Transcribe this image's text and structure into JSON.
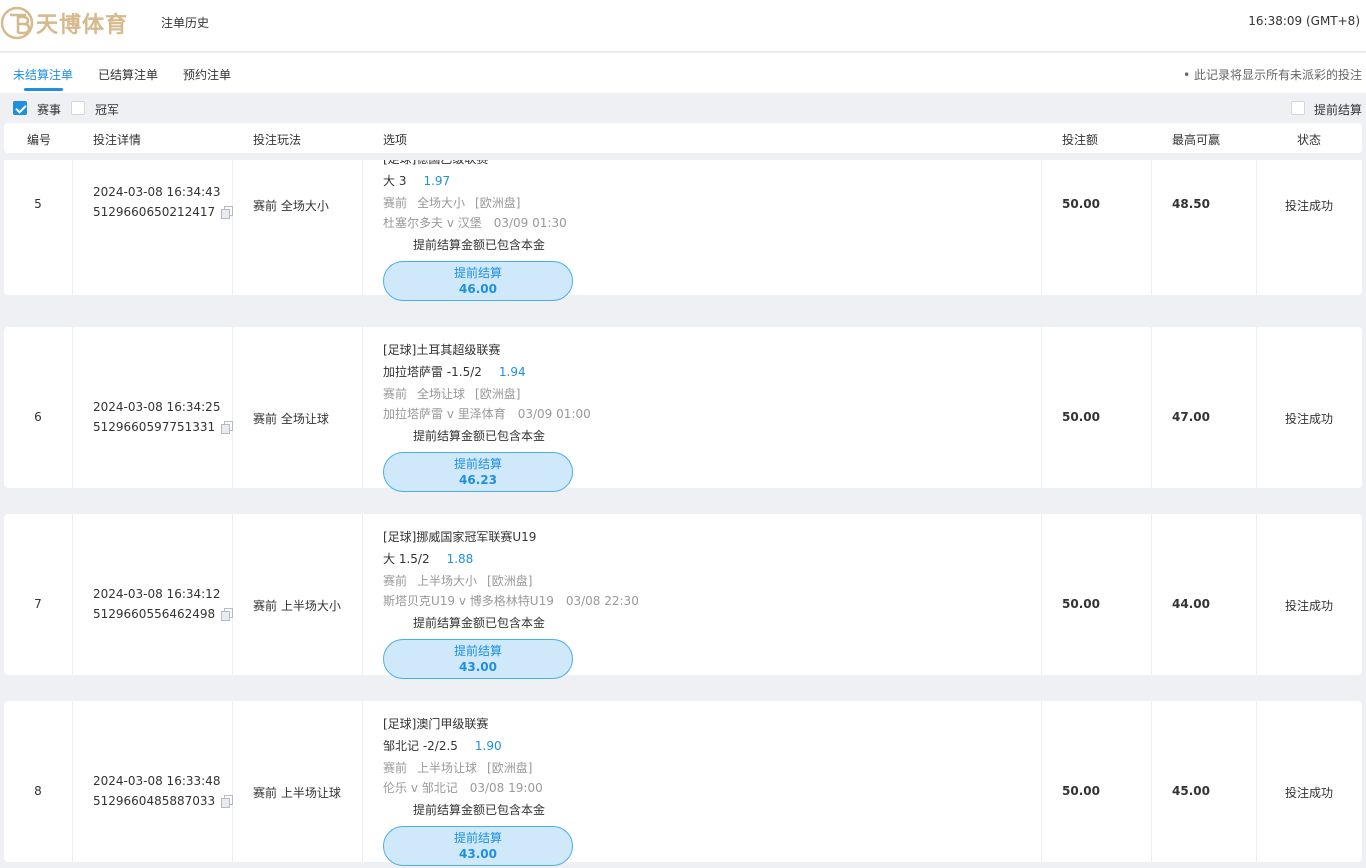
{
  "header": {
    "logo_text": "天博体育",
    "page_title": "注单历史",
    "clock": "16:38:09 (GMT+8)"
  },
  "tabs": [
    {
      "label": "未结算注单",
      "active": true
    },
    {
      "label": "已结算注单",
      "active": false
    },
    {
      "label": "预约注单",
      "active": false
    }
  ],
  "notice": "• 此记录将显示所有未派彩的投注",
  "filters": {
    "event": {
      "label": "赛事",
      "checked": true
    },
    "champion": {
      "label": "冠军",
      "checked": false
    },
    "early_settle": {
      "label": "提前结算",
      "checked": false
    }
  },
  "columns": {
    "num": "编号",
    "detail": "投注详情",
    "type": "投注玩法",
    "option": "选项",
    "stake": "投注额",
    "max_win": "最高可赢",
    "status": "状态"
  },
  "bets": [
    {
      "num": "5",
      "datetime": "2024-03-08 16:34:43",
      "bet_id": "5129660650212417",
      "type": "赛前 全场大小",
      "league": "[足球]德国乙级联赛",
      "pick": "大 3",
      "odds": "1.97",
      "meta": [
        "赛前",
        "全场大小",
        "[欧洲盘]"
      ],
      "match": "杜塞尔多夫 v 汉堡",
      "match_time": "03/09 01:30",
      "note": "提前结算金额已包含本金",
      "cashout_label": "提前结算",
      "cashout_amount": "46.00",
      "stake": "50.00",
      "max_win": "48.50",
      "status": "投注成功"
    },
    {
      "num": "6",
      "datetime": "2024-03-08 16:34:25",
      "bet_id": "5129660597751331",
      "type": "赛前 全场让球",
      "league": "[足球]土耳其超级联赛",
      "pick": "加拉塔萨雷 -1.5/2",
      "odds": "1.94",
      "meta": [
        "赛前",
        "全场让球",
        "[欧洲盘]"
      ],
      "match": "加拉塔萨雷 v 里泽体育",
      "match_time": "03/09 01:00",
      "note": "提前结算金额已包含本金",
      "cashout_label": "提前结算",
      "cashout_amount": "46.23",
      "stake": "50.00",
      "max_win": "47.00",
      "status": "投注成功"
    },
    {
      "num": "7",
      "datetime": "2024-03-08 16:34:12",
      "bet_id": "5129660556462498",
      "type": "赛前 上半场大小",
      "league": "[足球]挪威国家冠军联赛U19",
      "pick": "大 1.5/2",
      "odds": "1.88",
      "meta": [
        "赛前",
        "上半场大小",
        "[欧洲盘]"
      ],
      "match": "斯塔贝克U19 v 博多格林特U19",
      "match_time": "03/08 22:30",
      "note": "提前结算金额已包含本金",
      "cashout_label": "提前结算",
      "cashout_amount": "43.00",
      "stake": "50.00",
      "max_win": "44.00",
      "status": "投注成功"
    },
    {
      "num": "8",
      "datetime": "2024-03-08 16:33:48",
      "bet_id": "5129660485887033",
      "type": "赛前 上半场让球",
      "league": "[足球]澳门甲级联赛",
      "pick": "邹北记 -2/2.5",
      "odds": "1.90",
      "meta": [
        "赛前",
        "上半场让球",
        "[欧洲盘]"
      ],
      "match": "伦乐 v 邹北记",
      "match_time": "03/08 19:00",
      "note": "提前结算金额已包含本金",
      "cashout_label": "提前结算",
      "cashout_amount": "43.00",
      "stake": "50.00",
      "max_win": "45.00",
      "status": "投注成功"
    }
  ]
}
